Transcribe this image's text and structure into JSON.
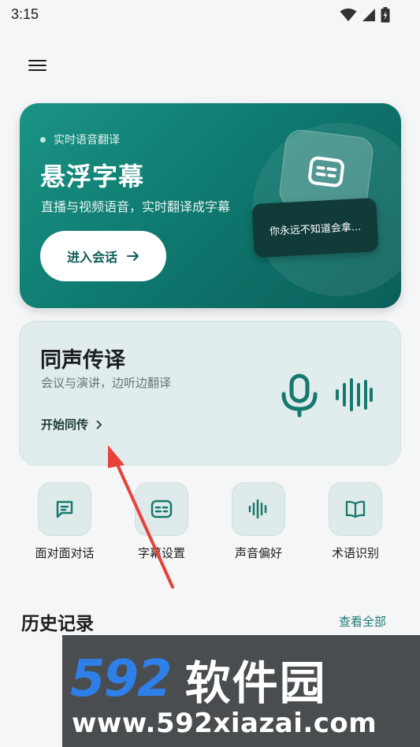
{
  "status_bar": {
    "time": "3:15",
    "icons": [
      "wifi-icon",
      "signal-icon",
      "battery-charging-icon"
    ]
  },
  "header": {
    "menu_icon": "menu-icon"
  },
  "hero": {
    "tag": "实时语音翻译",
    "title": "悬浮字幕",
    "subtitle": "直播与视频语音，实时翻译成字幕",
    "button_label": "进入会话",
    "bubble_text": "你永远不知道会拿...",
    "colors": {
      "gradient_start": "#1a9485",
      "gradient_end": "#0b5f5a"
    }
  },
  "interpretation": {
    "title": "同声传译",
    "subtitle": "会议与演讲，边听边翻译",
    "link_label": "开始同传"
  },
  "quick_actions": [
    {
      "label": "面对面对话",
      "icon": "chat-icon"
    },
    {
      "label": "字幕设置",
      "icon": "subtitles-icon"
    },
    {
      "label": "声音偏好",
      "icon": "waveform-icon"
    },
    {
      "label": "术语识别",
      "icon": "book-icon"
    }
  ],
  "history": {
    "title": "历史记录",
    "view_all": "查看全部"
  },
  "watermark": {
    "number": "592",
    "name": "软件园",
    "url": "www.592xiazai.com"
  },
  "accent_color": "#1d7b70"
}
